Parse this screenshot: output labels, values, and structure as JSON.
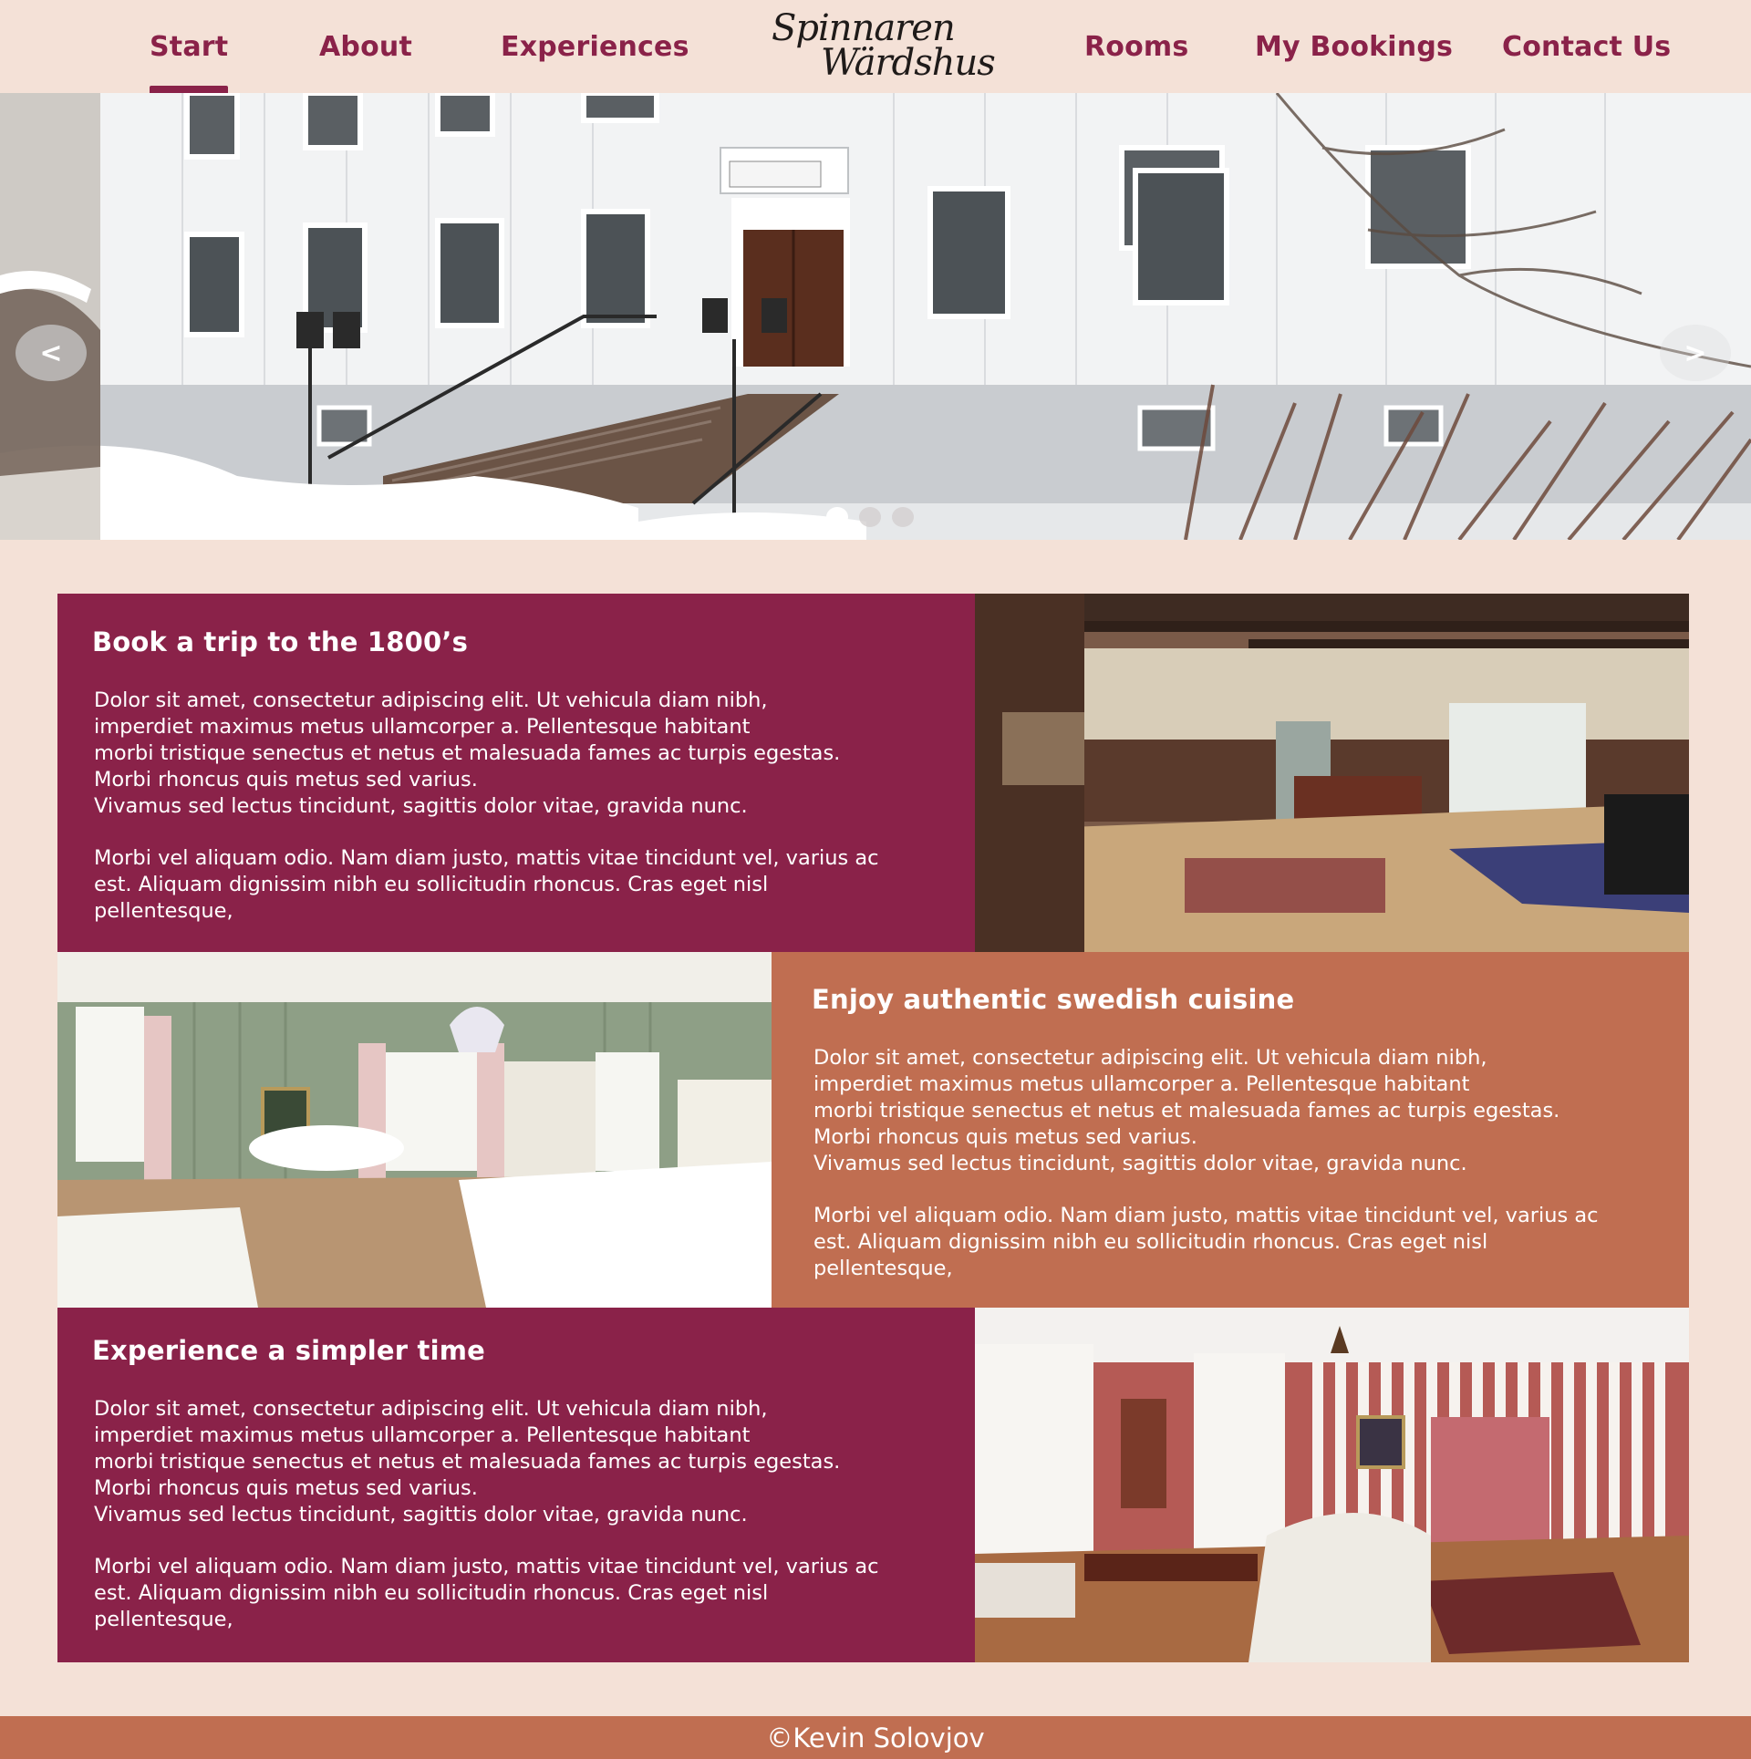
{
  "nav": {
    "items": [
      {
        "label": "Start",
        "active": true
      },
      {
        "label": "About",
        "active": false
      },
      {
        "label": "Experiences",
        "active": false
      },
      {
        "label": "Rooms",
        "active": false
      },
      {
        "label": "My Bookings",
        "active": false
      },
      {
        "label": "Contact Us",
        "active": false
      }
    ],
    "logo": {
      "line1": "Spinnaren",
      "line2": "Wärdshus"
    }
  },
  "hero": {
    "prev_icon": "chevron-left-icon",
    "next_icon": "chevron-right-icon",
    "prev_glyph": "<",
    "next_glyph": ">",
    "slide_count": 3,
    "active_slide": 1
  },
  "sections": [
    {
      "title": "Book a trip to the 1800’s",
      "paragraph1": "Dolor sit amet, consectetur adipiscing elit. Ut vehicula diam nibh,\nimperdiet maximus metus ullamcorper a. Pellentesque habitant\nmorbi tristique senectus et netus et malesuada fames ac turpis egestas.\nMorbi rhoncus quis metus sed varius.\nVivamus sed lectus tincidunt, sagittis dolor vitae, gravida nunc.",
      "paragraph2": "Morbi vel aliquam odio. Nam diam justo, mattis vitae tincidunt vel, varius ac\nest. Aliquam dignissim nibh eu sollicitudin rhoncus. Cras eget nisl\npellentesque,",
      "color": "#8a2249"
    },
    {
      "title": "Enjoy authentic swedish cuisine",
      "paragraph1": "Dolor sit amet, consectetur adipiscing elit. Ut vehicula diam nibh,\nimperdiet maximus metus ullamcorper a. Pellentesque habitant\nmorbi tristique senectus et netus et malesuada fames ac turpis egestas.\nMorbi rhoncus quis metus sed varius.\nVivamus sed lectus tincidunt, sagittis dolor vitae, gravida nunc.",
      "paragraph2": "Morbi vel aliquam odio. Nam diam justo, mattis vitae tincidunt vel, varius ac\nest. Aliquam dignissim nibh eu sollicitudin rhoncus. Cras eget nisl\npellentesque,",
      "color": "#c06e51"
    },
    {
      "title": "Experience a simpler time",
      "paragraph1": "Dolor sit amet, consectetur adipiscing elit. Ut vehicula diam nibh,\nimperdiet maximus metus ullamcorper a. Pellentesque habitant\nmorbi tristique senectus et netus et malesuada fames ac turpis egestas.\nMorbi rhoncus quis metus sed varius.\nVivamus sed lectus tincidunt, sagittis dolor vitae, gravida nunc.",
      "paragraph2": "Morbi vel aliquam odio. Nam diam justo, mattis vitae tincidunt vel, varius ac\nest. Aliquam dignissim nibh eu sollicitudin rhoncus. Cras eget nisl\npellentesque,",
      "color": "#8a2249"
    }
  ],
  "footer": {
    "text": "©Kevin Solovjov"
  },
  "colors": {
    "background": "#f4e1d7",
    "wine": "#8a2249",
    "rust": "#c06e51"
  }
}
